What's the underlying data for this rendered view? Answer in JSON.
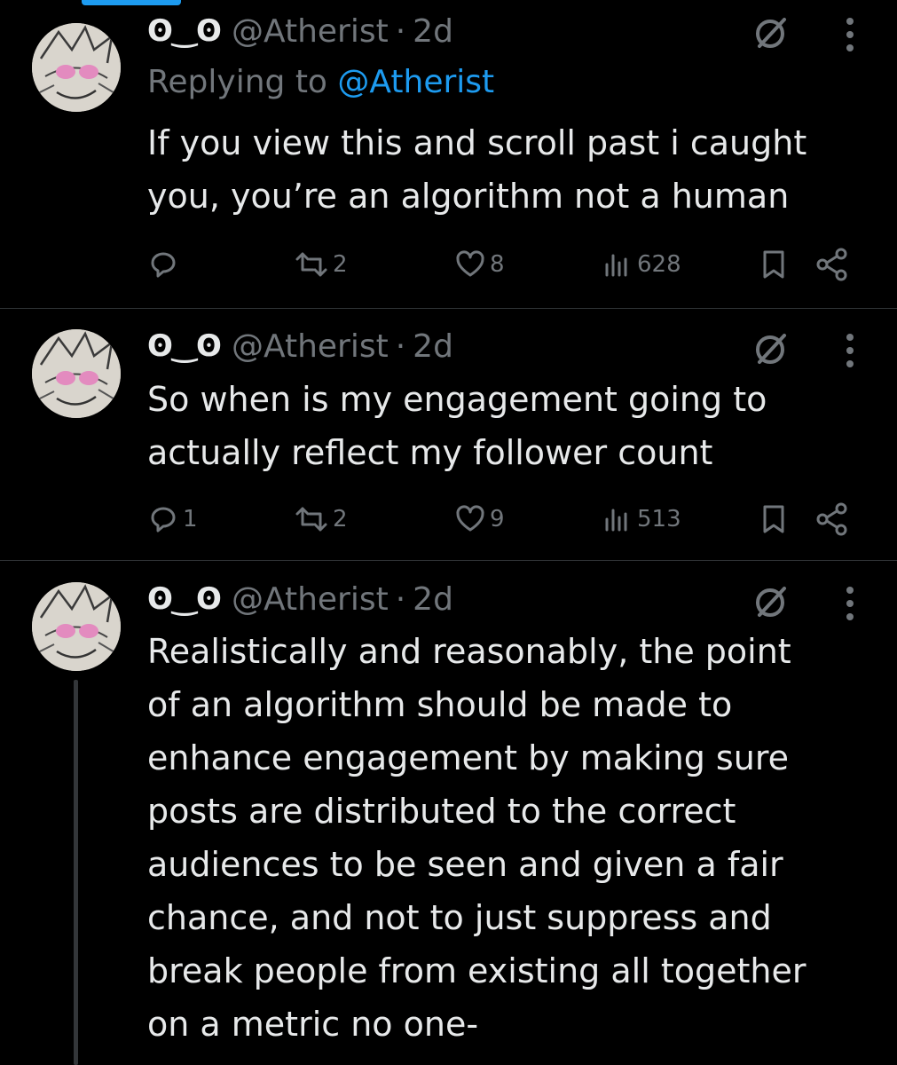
{
  "tweets": [
    {
      "display_name": "ʘ‿ʘ",
      "handle": "@Atherist",
      "separator": "·",
      "time": "2d",
      "replying_prefix": "Replying to",
      "replying_handle": "@Atherist",
      "text": "If you view this and scroll past i caught\nyou, you’re an algorithm not a human",
      "reply_count": "",
      "retweet_count": "2",
      "like_count": "8",
      "view_count": "628"
    },
    {
      "display_name": "ʘ‿ʘ",
      "handle": "@Atherist",
      "separator": "·",
      "time": "2d",
      "text": "So when is my engagement going to\nactually reflect my follower count",
      "reply_count": "1",
      "retweet_count": "2",
      "like_count": "9",
      "view_count": "513"
    },
    {
      "display_name": "ʘ‿ʘ",
      "handle": "@Atherist",
      "separator": "·",
      "time": "2d",
      "text": "Realistically and reasonably, the point\nof an algorithm should be made to\nenhance engagement by making sure\nposts are distributed to the correct\naudiences to be seen and given a fair\nchance, and not to just suppress and\nbreak people from existing all together\non a metric no one-"
    }
  ],
  "icons": {
    "grok": "grok-icon",
    "more": "more-dots-icon",
    "reply": "reply-icon",
    "retweet": "retweet-icon",
    "like": "heart-icon",
    "views": "views-icon",
    "bookmark": "bookmark-icon",
    "share": "share-icon"
  },
  "colors": {
    "background": "#000000",
    "text": "#e7e9ea",
    "muted": "#71767b",
    "link": "#1d9bf0",
    "divider": "#2f3336"
  }
}
